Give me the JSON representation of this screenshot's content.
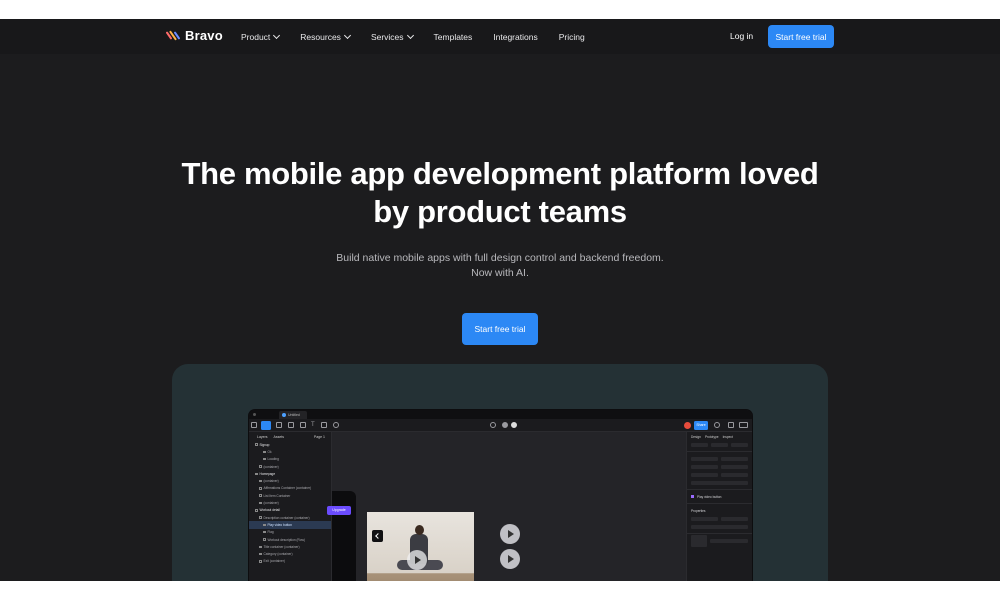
{
  "nav": {
    "brand": "Bravo",
    "items": [
      {
        "label": "Product",
        "dropdown": true
      },
      {
        "label": "Resources",
        "dropdown": true
      },
      {
        "label": "Services",
        "dropdown": true
      },
      {
        "label": "Templates",
        "dropdown": false
      },
      {
        "label": "Integrations",
        "dropdown": false
      },
      {
        "label": "Pricing",
        "dropdown": false
      }
    ],
    "login": "Log in",
    "cta": "Start free trial"
  },
  "hero": {
    "headline_line1": "The mobile app development platform loved",
    "headline_line2": "by product teams",
    "subtitle_line1": "Build native mobile apps with full design control and backend freedom.",
    "subtitle_line2": "Now with AI.",
    "cta": "Start free trial"
  },
  "app_preview": {
    "tab_title": "Untitled",
    "share_label": "Share",
    "panel_tabs": [
      "Layers",
      "Assets"
    ],
    "page_label": "Page 1",
    "upgrade_label": "Upgrade",
    "right_tabs": [
      "Design",
      "Prototype",
      "Inspect"
    ],
    "right_section_label": "Play video button",
    "right_properties_label": "Properties",
    "layers": [
      {
        "label": "Signup",
        "bold": true
      },
      {
        "label": "Ok",
        "bold": false
      },
      {
        "label": "Loading",
        "bold": false
      },
      {
        "label": "(container)",
        "bold": false
      },
      {
        "label": "Homepage",
        "bold": true
      },
      {
        "label": "(container)",
        "bold": false
      },
      {
        "label": "Affirmations Container (container)",
        "bold": false
      },
      {
        "label": "List Item Container",
        "bold": false
      },
      {
        "label": "(container)",
        "bold": false
      },
      {
        "label": "Workout detail",
        "bold": true
      },
      {
        "label": "Description container (container)",
        "bold": false
      },
      {
        "label": "Play video button",
        "bold": false,
        "selected": true
      },
      {
        "label": "Flag",
        "bold": false
      },
      {
        "label": "Workout description (Row)",
        "bold": false
      },
      {
        "label": "Title container (container)",
        "bold": false
      },
      {
        "label": "Category (container)",
        "bold": false
      },
      {
        "label": "Exit (container)",
        "bold": false
      }
    ]
  },
  "colors": {
    "page_bg": "#1c1c1e",
    "nav_bg": "#18181a",
    "accent": "#2c88f5",
    "showcase_bg": "#243135"
  }
}
